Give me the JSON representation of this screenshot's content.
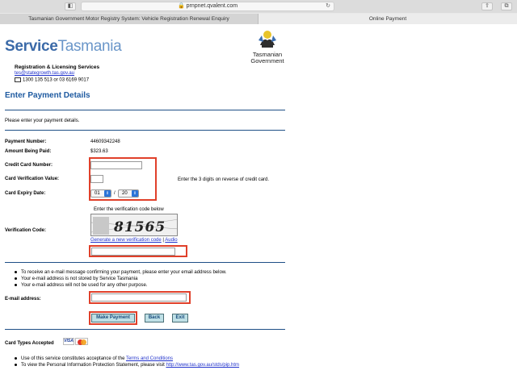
{
  "browser": {
    "address": "prnpnet.qvalent.com",
    "tabs": [
      {
        "label": "Tasmanian Government Motor Registry System: Vehicle Registration Renewal Enquiry"
      },
      {
        "label": "Online Payment"
      }
    ]
  },
  "header": {
    "brand_service": "Service",
    "brand_tasmania": "Tasmania",
    "gov_line1": "Tasmanian",
    "gov_line2": "Government",
    "org_name": "Registration & Licensing Services",
    "email": "tes@stategrowth.tas.gov.au",
    "phone": "1300 135 513 or 03 6169 9017"
  },
  "main": {
    "title": "Enter Payment Details",
    "intro": "Please enter your payment details.",
    "payment_number_label": "Payment Number:",
    "payment_number": "44609342248",
    "amount_label": "Amount Being Paid:",
    "amount": "$323.63",
    "card_number_label": "Credit Card Number:",
    "cvv_label": "Card Verification Value:",
    "cvv_hint": "Enter the 3 digits on reverse of credit card.",
    "expiry_label": "Card Expiry Date:",
    "expiry_month": "01",
    "expiry_separator": "/",
    "expiry_year": "20",
    "verification_instruction": "Enter the verification code below",
    "verification_label": "Verification Code:",
    "captcha_text": "81565",
    "generate_link": "Generate a new verification code",
    "link_separator": "|",
    "audio_link": "Audio"
  },
  "email_section": {
    "bullets": [
      "To receive an e-mail message confirming your payment, please enter your email address below.",
      "Your e-mail address is not stored by Service Tasmania",
      "Your e-mail address will not be used for any other purpose."
    ],
    "email_label": "E-mail address:"
  },
  "buttons": {
    "make_payment": "Make Payment",
    "back": "Back",
    "exit": "Exit"
  },
  "footer": {
    "card_types_label": "Card Types Accepted",
    "visa": "VISA",
    "bullet1_prefix": "Use of this service constitutes acceptance of the ",
    "bullet1_link": "Terms and Conditions",
    "bullet2_prefix": "To view the Personal Information Protection Statement, please visit ",
    "bullet2_link": "http://www.tas.gov.au/stds/pip.htm"
  },
  "colors": {
    "accent": "#1e5aa0",
    "highlight": "#e0402a",
    "button_bg": "#bfe0e6"
  }
}
